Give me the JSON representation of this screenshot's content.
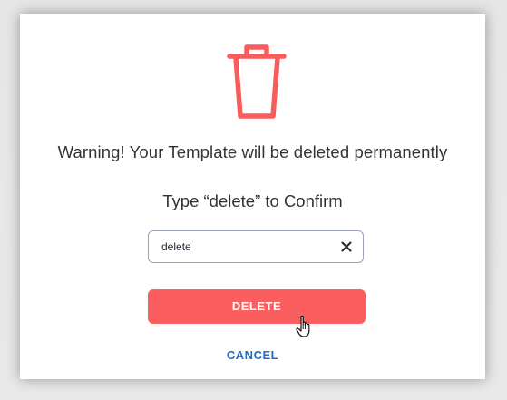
{
  "dialog": {
    "icon": "trash-icon",
    "warning_text": "Warning! Your Template will be deleted permanently",
    "prompt_text": "Type “delete” to Confirm",
    "input": {
      "value": "delete",
      "placeholder": ""
    },
    "clear_icon": "close-icon",
    "delete_label": "DELETE",
    "cancel_label": "CANCEL"
  },
  "colors": {
    "accent_danger": "#fb5e5e",
    "link_blue": "#1a6ecf",
    "text_dark": "#333333"
  }
}
